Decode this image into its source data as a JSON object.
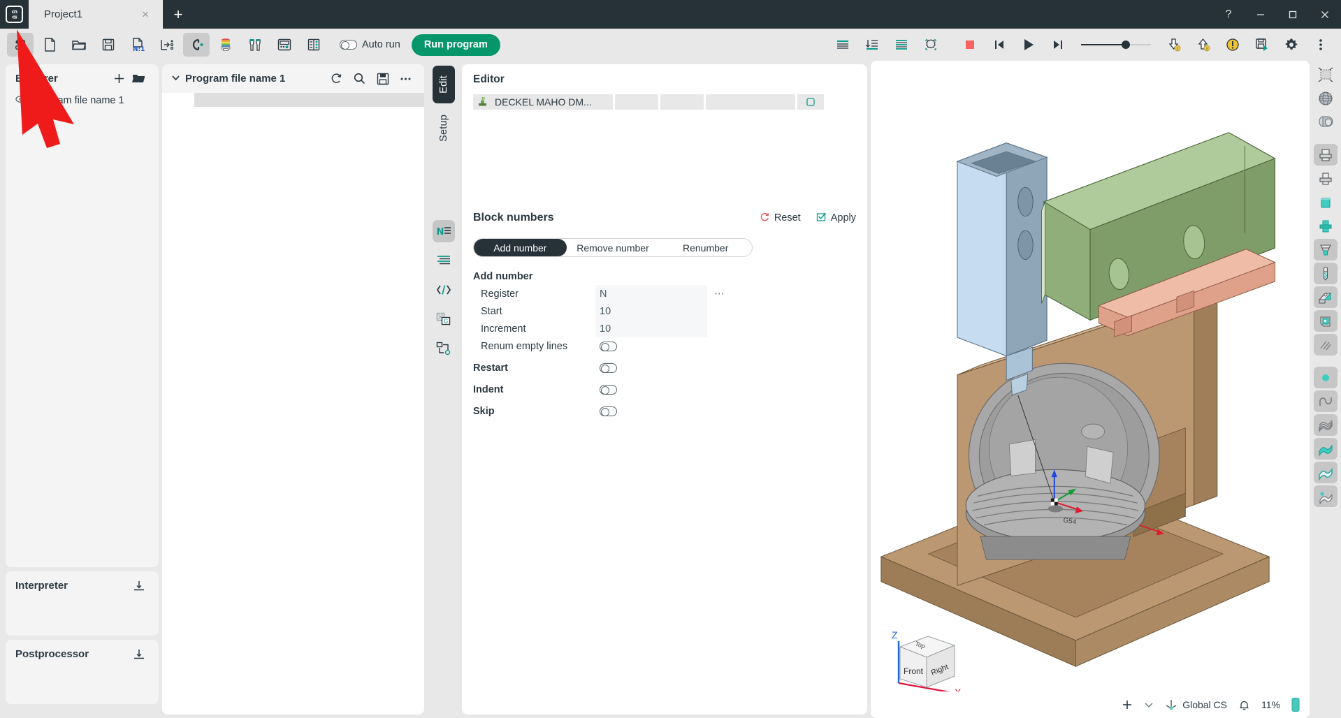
{
  "titlebar": {
    "logo_text": "GN\nCS",
    "tab_label": "Project1",
    "tab_close": "×",
    "new_tab": "+",
    "help": "?",
    "minimize": "—",
    "maximize": "❐",
    "close": "✕"
  },
  "toolbar": {
    "buttons": [
      {
        "name": "grid-view-icon",
        "tip": "Grid view",
        "active": true
      },
      {
        "name": "new-file-icon",
        "tip": "New file",
        "active": false
      },
      {
        "name": "open-folder-icon",
        "tip": "Open",
        "active": false
      },
      {
        "name": "save-icon",
        "tip": "Save",
        "active": false
      },
      {
        "name": "numbered-file-icon",
        "tip": "N:1",
        "active": false
      },
      {
        "name": "export-icon",
        "tip": "Export",
        "active": false
      },
      {
        "name": "magnet-icon",
        "tip": "Snap",
        "active": true
      },
      {
        "name": "colors-icon",
        "tip": "Colors",
        "active": false
      },
      {
        "name": "tools-icon",
        "tip": "Tools",
        "active": false
      },
      {
        "name": "controller-icon",
        "tip": "Controller",
        "active": false
      },
      {
        "name": "list-icon",
        "tip": "List",
        "active": false
      }
    ],
    "auto_run_label": "Auto run",
    "auto_run_on": false,
    "run_program_label": "Run program",
    "right_buttons": [
      {
        "name": "align-text-icon",
        "tip": "Format"
      },
      {
        "name": "indent-down-icon",
        "tip": "Indent"
      },
      {
        "name": "lines-icon",
        "tip": "Lines"
      },
      {
        "name": "gear-outline-icon",
        "tip": "Settings"
      },
      {
        "name": "stop-icon",
        "tip": "Stop"
      },
      {
        "name": "skip-start-icon",
        "tip": "Go to start"
      },
      {
        "name": "play-icon",
        "tip": "Play"
      },
      {
        "name": "skip-end-icon",
        "tip": "Go to end"
      }
    ],
    "speed_slider_value": 62,
    "trailing_buttons": [
      {
        "name": "download-warning-icon",
        "tip": "Import"
      },
      {
        "name": "upload-warning-icon",
        "tip": "Upload"
      },
      {
        "name": "warning-circle-icon",
        "tip": "Warnings"
      },
      {
        "name": "save-run-icon",
        "tip": "Save & run"
      },
      {
        "name": "gear-icon",
        "tip": "Settings"
      },
      {
        "name": "more-vertical-icon",
        "tip": "More"
      }
    ]
  },
  "sidebar": {
    "explorer": {
      "title": "Explorer",
      "add_label": "+",
      "open_folder_label": "folder-icon",
      "items": [
        {
          "label": "Program file name 1",
          "icon": "eye-icon"
        }
      ]
    },
    "interpreter": {
      "title": "Interpreter",
      "action": "download-icon"
    },
    "postprocessor": {
      "title": "Postprocessor",
      "action": "download-icon"
    }
  },
  "program_panel": {
    "title": "Program file name 1",
    "collapse_icon": "chevron-down-icon",
    "actions": [
      "refresh-icon",
      "search-icon",
      "save-icon",
      "more-icon"
    ]
  },
  "vertical_tabs": [
    {
      "label": "Edit",
      "active": true
    },
    {
      "label": "Setup",
      "active": false
    }
  ],
  "vertical_icons": [
    {
      "name": "block-number-icon",
      "label": "N",
      "selected": true
    },
    {
      "name": "lines-indent-icon",
      "label": "",
      "selected": false
    },
    {
      "name": "code-brackets-icon",
      "label": "</>",
      "selected": false
    },
    {
      "name": "replace-icon",
      "label": "",
      "selected": false
    },
    {
      "name": "flowchart-icon",
      "label": "",
      "selected": false
    }
  ],
  "editor": {
    "title": "Editor",
    "file_row": {
      "icon": "machine-icon",
      "name": "DECKEL MAHO DM...",
      "trailing_icon": "copy-icon"
    }
  },
  "block_numbers": {
    "title": "Block numbers",
    "reset_label": "Reset",
    "apply_label": "Apply",
    "reset_icon": "reset-icon",
    "apply_icon": "apply-check-icon",
    "tabs": [
      {
        "label": "Add number",
        "active": true
      },
      {
        "label": "Remove number",
        "active": false
      },
      {
        "label": "Renumber",
        "active": false
      }
    ],
    "group_title": "Add number",
    "fields": [
      {
        "label": "Register",
        "value": "N",
        "type": "text",
        "has_more": true,
        "bold": false
      },
      {
        "label": "Start",
        "value": "10",
        "type": "text",
        "has_more": false,
        "bold": false
      },
      {
        "label": "Increment",
        "value": "10",
        "type": "text",
        "has_more": false,
        "bold": false
      },
      {
        "label": "Renum empty lines",
        "value": "",
        "type": "toggle",
        "on": false,
        "bold": false
      },
      {
        "label": "Restart",
        "value": "",
        "type": "toggle",
        "on": false,
        "bold": true
      },
      {
        "label": "Indent",
        "value": "",
        "type": "toggle",
        "on": false,
        "bold": true
      },
      {
        "label": "Skip",
        "value": "",
        "type": "toggle",
        "on": false,
        "bold": true
      }
    ]
  },
  "viewport": {
    "viewcube": {
      "front": "Front",
      "top": "Top",
      "right": "Right",
      "axis_z": "Z",
      "axis_x": "X"
    },
    "workpiece_label": "G54",
    "status": {
      "add_label": "+",
      "dropdown_icon": "chevron-down-icon",
      "cs_icon": "axis-icon",
      "cs_label": "Global CS",
      "bell_icon": "bell-icon",
      "zoom_label": "11%",
      "battery_icon": "battery-icon"
    },
    "colors": {
      "tool_body": "#c6dcf0",
      "tool_dark": "#8b9fae",
      "green_part": "#8fae7a",
      "salmon_part": "#e0a18b",
      "table_brown": "#b5916d",
      "machine_grey": "#9e9e9e"
    }
  },
  "right_rail": [
    {
      "name": "bounding-box-icon",
      "selected": false
    },
    {
      "name": "globe-wireframe-icon",
      "selected": false
    },
    {
      "name": "solid-shape-icon",
      "selected": false
    },
    {
      "name": "stock-top-icon",
      "selected": true
    },
    {
      "name": "stock-icon",
      "selected": false
    },
    {
      "name": "stock-teal-icon",
      "selected": false
    },
    {
      "name": "stock-teal-small-icon",
      "selected": false
    },
    {
      "name": "fixture-icon",
      "selected": true
    },
    {
      "name": "endmill-icon",
      "selected": true
    },
    {
      "name": "clamp-icon",
      "selected": true
    },
    {
      "name": "folded-part-icon",
      "selected": true
    },
    {
      "name": "hatch-icon",
      "selected": true
    },
    {
      "name": "point-icon",
      "selected": true
    },
    {
      "name": "curve-icon",
      "selected": true
    },
    {
      "name": "mesh-surface-icon",
      "selected": true
    },
    {
      "name": "surface-teal-icon",
      "selected": true
    },
    {
      "name": "surface-outline-icon",
      "selected": true
    },
    {
      "name": "surface-point-icon",
      "selected": true
    }
  ]
}
